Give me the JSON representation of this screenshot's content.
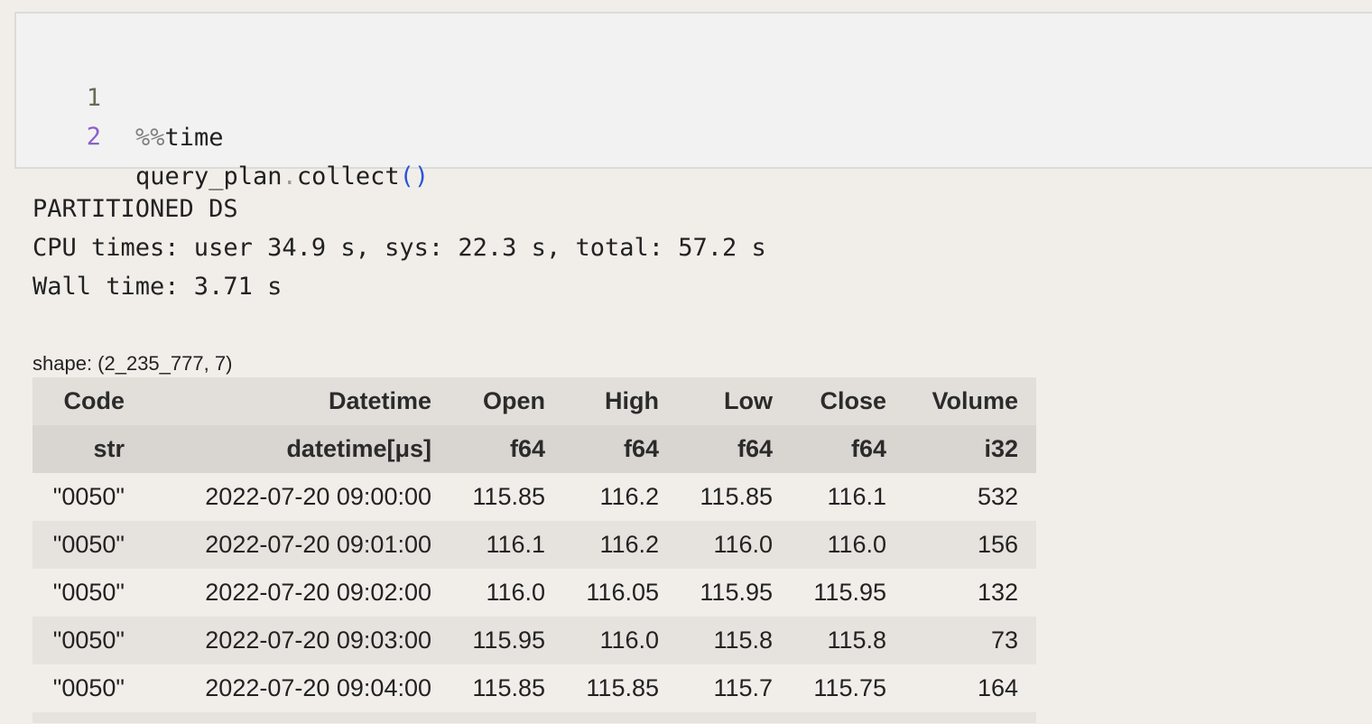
{
  "code_cell": {
    "lines": [
      {
        "number": "1",
        "magic": "%%",
        "text": "time"
      },
      {
        "number": "2",
        "object": "query_plan",
        "dot": ".",
        "method": "collect",
        "parens": "()"
      }
    ]
  },
  "output": {
    "stdout": [
      "PARTITIONED DS",
      "CPU times: user 34.9 s, sys: 22.3 s, total: 57.2 s",
      "Wall time: 3.71 s"
    ],
    "shape": "shape: (2_235_777, 7)"
  },
  "dataframe": {
    "columns": [
      "Code",
      "Datetime",
      "Open",
      "High",
      "Low",
      "Close",
      "Volume"
    ],
    "dtypes": [
      "str",
      "datetime[μs]",
      "f64",
      "f64",
      "f64",
      "f64",
      "i32"
    ],
    "rows": [
      [
        "\"0050\"",
        "2022-07-20 09:00:00",
        "115.85",
        "116.2",
        "115.85",
        "116.1",
        "532"
      ],
      [
        "\"0050\"",
        "2022-07-20 09:01:00",
        "116.1",
        "116.2",
        "116.0",
        "116.0",
        "156"
      ],
      [
        "\"0050\"",
        "2022-07-20 09:02:00",
        "116.0",
        "116.05",
        "115.95",
        "115.95",
        "132"
      ],
      [
        "\"0050\"",
        "2022-07-20 09:03:00",
        "115.95",
        "116.0",
        "115.8",
        "115.8",
        "73"
      ],
      [
        "\"0050\"",
        "2022-07-20 09:04:00",
        "115.85",
        "115.85",
        "115.7",
        "115.75",
        "164"
      ]
    ]
  }
}
